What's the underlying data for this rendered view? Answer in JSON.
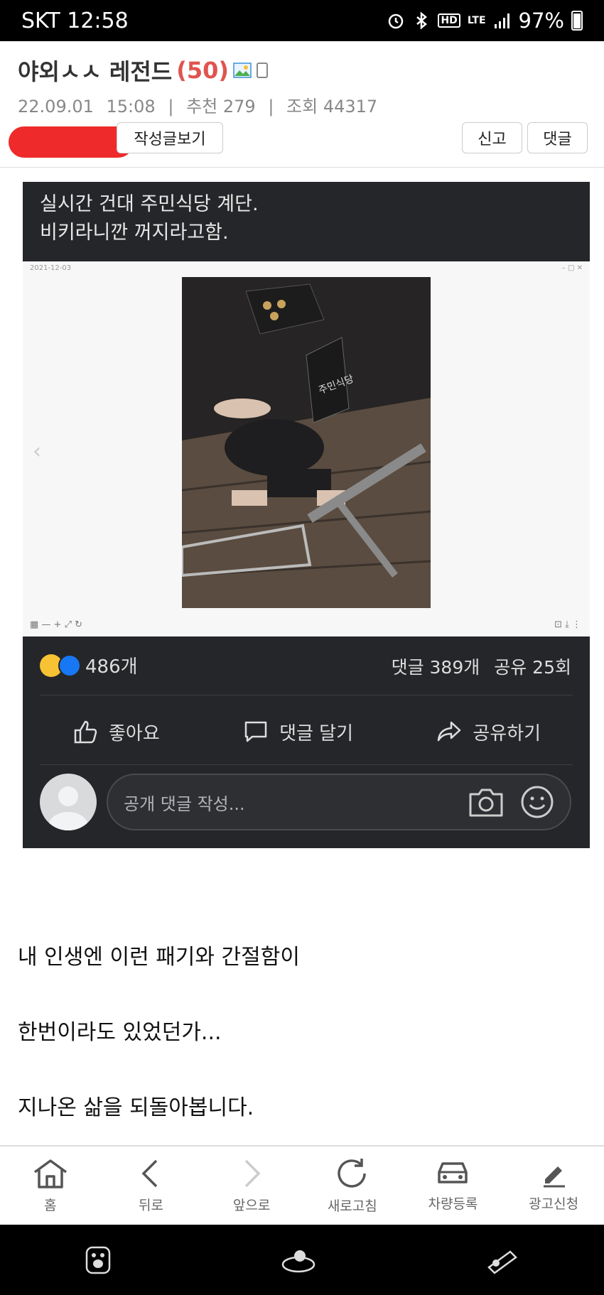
{
  "status": {
    "carrier_time": "SKT 12:58",
    "battery": "97%",
    "lte": "LTE",
    "hd": "HD"
  },
  "post": {
    "title": "야외ㅅㅅ 레전드",
    "comment_count": "(50)",
    "date": "22.09.01",
    "time": "15:08",
    "recommend": "추천 279",
    "views": "조회 44317"
  },
  "buttons": {
    "view_posts": "작성글보기",
    "report": "신고",
    "comment": "댓글"
  },
  "embed": {
    "caption_line1": "실시간 건대 주민식당 계단.",
    "caption_line2": "비키라니깐 꺼지라고함.",
    "viewer_date": "2021-12-03",
    "sign_text": "주민식당",
    "reaction_count": "486개",
    "comments_stat": "댓글 389개",
    "shares_stat": "공유 25회",
    "like_label": "좋아요",
    "comment_label": "댓글 달기",
    "share_label": "공유하기",
    "comment_placeholder": "공개 댓글 작성..."
  },
  "body": {
    "line1": "내 인생엔 이런 패기와 간절함이",
    "line2": "한번이라도 있었던가...",
    "line3": "지나온 삶을 되돌아봅니다."
  },
  "nav": {
    "home": "홈",
    "back": "뒤로",
    "forward": "앞으로",
    "refresh": "새로고침",
    "car": "차량등록",
    "ad": "광고신청"
  }
}
